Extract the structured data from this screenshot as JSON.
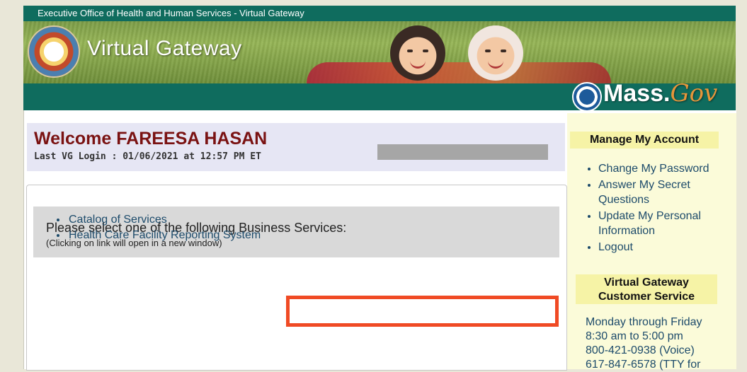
{
  "header": {
    "top_bar_text": "Executive Office of Health and Human Services - Virtual Gateway",
    "site_title": "Virtual Gateway",
    "mass_logo_main": "Mass.",
    "mass_logo_gov": "Gov"
  },
  "welcome": {
    "title": "Welcome FAREESA HASAN",
    "last_login": "Last VG Login : 01/06/2021 at 12:57 PM ET"
  },
  "services": {
    "prompt": "Please select one of the following Business Services:",
    "note": "(Clicking on link will open in a new window)",
    "items": [
      "Catalog of Services",
      "Health Care Facility Reporting System"
    ]
  },
  "sidebar": {
    "manage_header": "Manage My Account",
    "manage_items": [
      "Change My Password",
      "Answer My Secret Questions",
      "Update My Personal Information",
      "Logout"
    ],
    "cs_header_line1": "Virtual Gateway",
    "cs_header_line2": "Customer Service",
    "cs_lines": [
      "Monday through Friday",
      "8:30 am to 5:00 pm",
      "800-421-0938 (Voice)",
      "617-847-6578 (TTY for"
    ]
  },
  "colors": {
    "brand_teal": "#0f6c5e",
    "welcome_red": "#7a1212",
    "link_blue": "#1d4b6b",
    "highlight_orange": "#f04a24",
    "sidebar_yellow": "#fbfbd9"
  }
}
